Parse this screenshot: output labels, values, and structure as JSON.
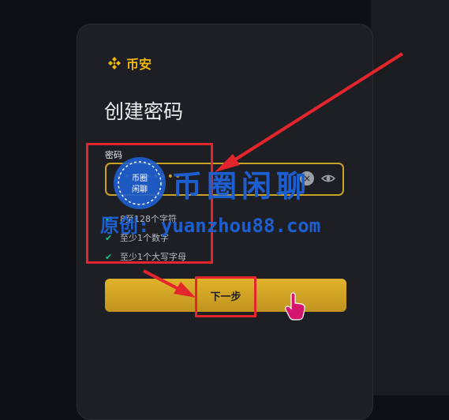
{
  "brand": {
    "name": "币安",
    "color": "#f0b90b"
  },
  "page": {
    "title": "创建密码"
  },
  "password_field": {
    "label": "密码",
    "masked_value": "•••••••••",
    "clear_icon": "clear-icon",
    "visibility_icon": "eye-icon"
  },
  "hints": [
    {
      "text": "8至128个字符",
      "met": true
    },
    {
      "text": "至少1个数字",
      "met": true
    },
    {
      "text": "至少1个大写字母",
      "met": true
    }
  ],
  "next_button": {
    "label": "下一步",
    "color": "#d9aa26"
  },
  "watermark": {
    "title": "币圈闲聊",
    "url_line": "原创: yuanzhou88.com",
    "stamp_text": [
      "币圈",
      "闲聊"
    ],
    "color": "#1d5fd1"
  },
  "annotation": {
    "color": "#e3262c"
  }
}
